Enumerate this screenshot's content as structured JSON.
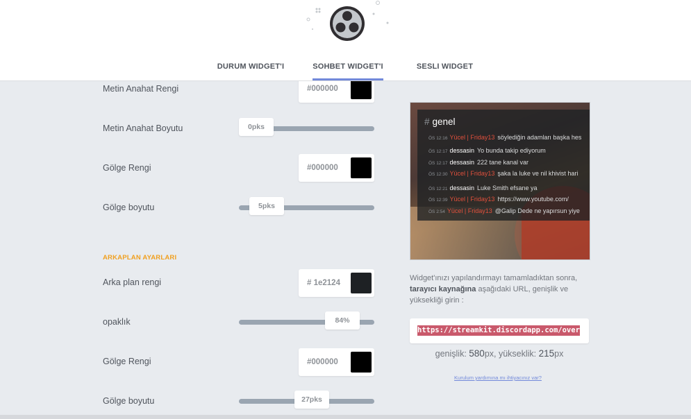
{
  "tabs": [
    {
      "label": "DURUM WIDGET'I",
      "active": false
    },
    {
      "label": "SOHBET WIDGET'I",
      "active": true
    },
    {
      "label": "SESLI WIDGET",
      "active": false
    }
  ],
  "settings": {
    "outline_color": {
      "label": "Metin Anahat Rengi",
      "hex": "#000000",
      "color": "#000000"
    },
    "outline_size": {
      "label": "Metin Anahat Boyutu",
      "value": "0pks",
      "fraction": 0
    },
    "shadow_color_1": {
      "label": "Gölge Rengi",
      "hex": "#000000",
      "color": "#000000"
    },
    "shadow_size_1": {
      "label": "Gölge boyutu",
      "value": "5pks",
      "fraction": 0.11
    },
    "background_section": "ARKAPLAN AYARLARI",
    "bg_color": {
      "label": "Arka plan rengi",
      "hex": "# 1e2124",
      "color": "#1e2124"
    },
    "opacity": {
      "label": "opaklık",
      "value": "84%",
      "fraction": 0.84
    },
    "shadow_color_2": {
      "label": "Gölge Rengi",
      "hex": "#000000",
      "color": "#000000"
    },
    "shadow_size_2": {
      "label": "Gölge boyutu",
      "value": "27pks",
      "fraction": 0.54
    }
  },
  "preview": {
    "channel_hash": "#",
    "channel": "genel",
    "messages": [
      {
        "time": "ÖS 12:16",
        "user": "Yücel | Friday13",
        "user_color": "#e0503c",
        "text": "söylediğin adamları başka hes"
      },
      {
        "time": "ÖS 12:17",
        "user": "dessasin",
        "user_color": "#ffffff",
        "text": "Yo bunda takip ediyorum"
      },
      {
        "time": "ÖS 12:17",
        "user": "dessasin",
        "user_color": "#ffffff",
        "text": "222 tane kanal var"
      },
      {
        "time": "ÖS 12:30",
        "user": "Yücel | Friday13",
        "user_color": "#e0503c",
        "text": "şaka la luke ve nil khivist hari"
      },
      {
        "time": "ÖS 12:21",
        "user": "dessasin",
        "user_color": "#ffffff",
        "text": "Luke Smith efsane ya"
      },
      {
        "time": "ÖS 12:39",
        "user": "Yücel | Friday13",
        "user_color": "#e0503c",
        "text": "https://www.youtube.com/"
      },
      {
        "time": "ÖS 2:54",
        "user": "Yücel | Friday13",
        "user_color": "#e0503c",
        "text": "@Galip Dede ne yapırsun yiye"
      }
    ]
  },
  "info": {
    "line1": "Widget'ınızı yapılandırmayı tamamladıktan sonra,",
    "bold": "tarayıcı kaynağına",
    "line2": " aşağıdaki URL, genişlik ve yüksekliği girin :"
  },
  "url": "https://streamkit.discordapp.com/overlay/chat",
  "dimensions": {
    "width_label": "genişlik: ",
    "width_value": "580",
    "width_unit": "px, ",
    "height_label": "yükseklik: ",
    "height_value": "215",
    "height_unit": "px"
  },
  "help_link": "Kurulum yardımına mı ihtiyacınız var?",
  "colors": {
    "accent": "#7289da",
    "section": "#f0a020",
    "url_highlight": "#c9596b"
  }
}
